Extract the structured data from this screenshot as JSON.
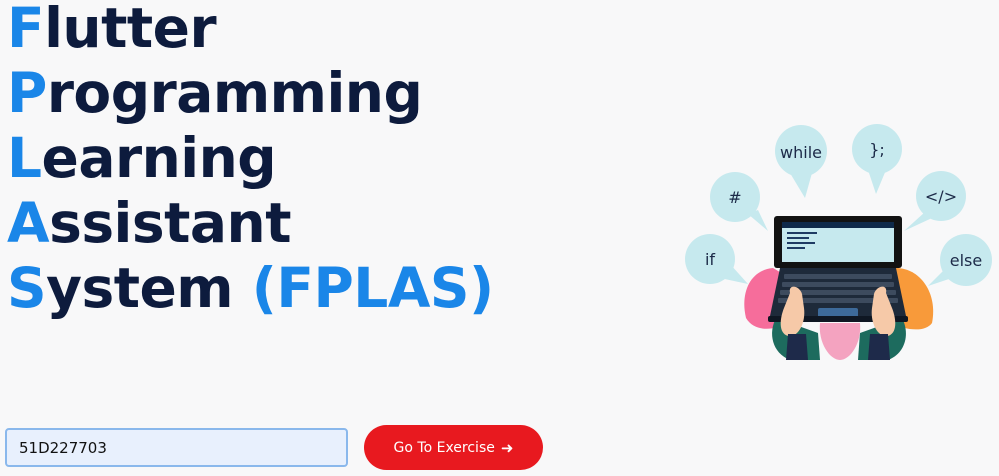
{
  "title": {
    "lines": [
      {
        "initial": "F",
        "rest": "lutter"
      },
      {
        "initial": "P",
        "rest": "rogramming"
      },
      {
        "initial": "L",
        "rest": "earning"
      },
      {
        "initial": "A",
        "rest": "ssistant"
      },
      {
        "initial": "S",
        "rest": "ystem"
      }
    ],
    "acronym": "(FPLAS)"
  },
  "illustration": {
    "bubbles": [
      "if",
      "#",
      "while",
      "};",
      "</>",
      "else"
    ]
  },
  "exercise": {
    "input_value": "51D227703",
    "button_label": "Go To Exercise",
    "button_icon": "arrow-right-icon"
  },
  "colors": {
    "accent_blue": "#1a86e8",
    "title_dark": "#0d1b3d",
    "button_red": "#e8191f",
    "input_bg": "#e8f0fd"
  }
}
